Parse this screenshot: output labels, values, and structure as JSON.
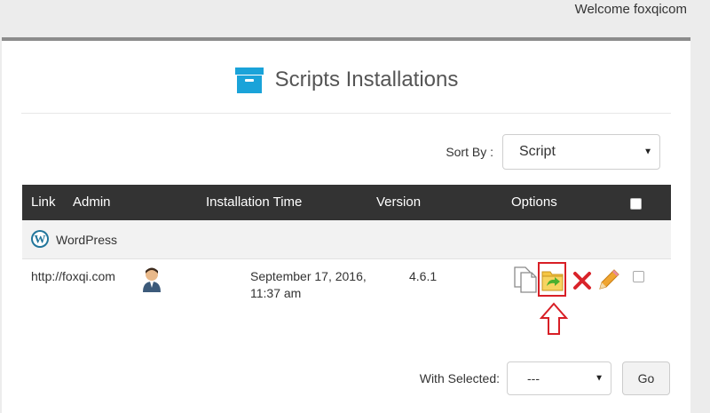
{
  "header": {
    "welcome": "Welcome foxqicom"
  },
  "page": {
    "title": "Scripts Installations",
    "title_icon": "archive-box-icon"
  },
  "sort": {
    "label": "Sort By :",
    "value": "Script"
  },
  "table": {
    "columns": {
      "link": "Link",
      "admin": "Admin",
      "installation_time": "Installation Time",
      "version": "Version",
      "options": "Options"
    },
    "group": {
      "name": "WordPress",
      "icon": "wordpress-icon"
    },
    "rows": [
      {
        "link": "http://foxqi.com",
        "admin_icon": "admin-user-icon",
        "installation_time_line1": "September 17, 2016,",
        "installation_time_line2": "11:37 am",
        "version": "4.6.1",
        "options": [
          "clone-icon",
          "backup-icon",
          "remove-icon",
          "edit-icon"
        ],
        "checked": false
      }
    ]
  },
  "bulk": {
    "label": "With Selected:",
    "value": "---",
    "go_label": "Go"
  },
  "colors": {
    "header_bg": "#333333",
    "accent_blue": "#1aa3d9",
    "highlight_red": "#d81f26"
  }
}
